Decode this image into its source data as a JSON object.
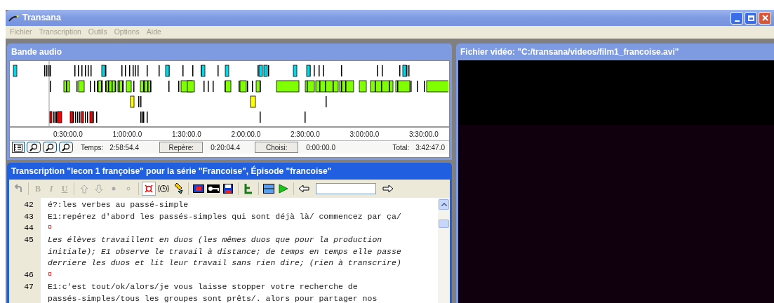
{
  "window": {
    "title": "Transana"
  },
  "menu": [
    "Fichier",
    "Transcription",
    "Outils",
    "Options",
    "Aide"
  ],
  "audio_panel": {
    "title": "Bande audio",
    "ticks": [
      "0:30:00.0",
      "1:00:00.0",
      "1:30:00.0",
      "2:00:00.0",
      "2:30:00.0",
      "3:00:00.0",
      "3:30:00.0"
    ],
    "status": {
      "time_label": "Temps:",
      "time": "2:58:54.4",
      "mark_button": "Repère:",
      "mark": "0:20:04.4",
      "selected_button": "Choisi:",
      "selected": "0:00:00.0",
      "total_label": "Total:",
      "total": "3:42:47.0"
    }
  },
  "transcript_panel": {
    "title": "Transcription \"lecon 1 françoise\" pour la série \"Francoise\", Épisode \"francoise\"",
    "format_buttons": [
      {
        "label": "B",
        "disabled": true
      },
      {
        "label": "I",
        "disabled": true
      },
      {
        "label": "U",
        "disabled": true
      }
    ],
    "marker_toggle": {
      "pressed": true
    },
    "lines": [
      {
        "number": "42",
        "kind": "text",
        "lines": [
          "é?:les verbes au passé-simple"
        ]
      },
      {
        "number": "43",
        "kind": "text",
        "lines": [
          "E1:repérez d'abord les passés-simples qui sont déjà là/ commencez par ça/"
        ]
      },
      {
        "number": "44",
        "kind": "marker",
        "lines": [
          "¤"
        ]
      },
      {
        "number": "45",
        "kind": "italic",
        "lines": [
          "Les élèves travaillent en duos (les mêmes duos que pour la production",
          "initiale); E1 observe le travail à distance; de temps en temps elle passe",
          "derriere les duos et lit leur travail sans rien dire; (rien à transcrire)"
        ]
      },
      {
        "number": "46",
        "kind": "marker",
        "lines": [
          "¤"
        ]
      },
      {
        "number": "47",
        "kind": "text",
        "lines": [
          "E1:c'est tout/ok/alors/je vous laisse stopper votre recherche de",
          "passés-simples/tous les groupes sont prêts/. alors pour partager nos"
        ]
      }
    ]
  },
  "video_panel": {
    "title": "Fichier vidéo: \"C:/transana/videos/film1_francoise.avi\""
  }
}
